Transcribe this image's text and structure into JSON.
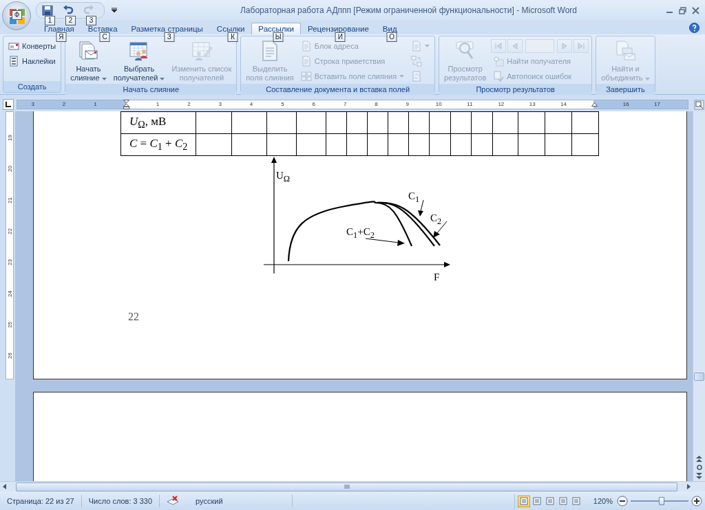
{
  "window": {
    "title": "Лабораторная работа АДппп [Режим ограниченной функциональности] - Microsoft Word"
  },
  "office_button": {
    "keytip": "Ф"
  },
  "quick_access": [
    {
      "keytip": "1",
      "disabled": false
    },
    {
      "keytip": "2",
      "disabled": false
    },
    {
      "keytip": "3",
      "disabled": true
    }
  ],
  "tabs": [
    {
      "label": "Главная",
      "keytip": "Я",
      "selected": false
    },
    {
      "label": "Вставка",
      "keytip": "С",
      "selected": false
    },
    {
      "label": "Разметка страницы",
      "keytip": "З",
      "selected": false
    },
    {
      "label": "Ссылки",
      "keytip": "К",
      "selected": false
    },
    {
      "label": "Рассылки",
      "keytip": "Ы",
      "selected": true
    },
    {
      "label": "Рецензирование",
      "keytip": "И",
      "selected": false
    },
    {
      "label": "Вид",
      "keytip": "О",
      "selected": false
    }
  ],
  "ribbon": {
    "groups": [
      {
        "title": "Создать",
        "items": [
          {
            "kind": "stack",
            "items": [
              {
                "kind": "small",
                "label": "Конверты",
                "disabled": false,
                "dropdown": false
              },
              {
                "kind": "small",
                "label": "Наклейки",
                "disabled": false,
                "dropdown": false
              }
            ]
          }
        ]
      },
      {
        "title": "Начать слияние",
        "items": [
          {
            "kind": "large",
            "lines": [
              "Начать",
              "слияние"
            ],
            "dropdown": true,
            "disabled": false
          },
          {
            "kind": "large",
            "lines": [
              "Выбрать",
              "получателей"
            ],
            "dropdown": true,
            "disabled": false
          },
          {
            "kind": "large",
            "lines": [
              "Изменить список",
              "получателей"
            ],
            "dropdown": false,
            "disabled": true
          }
        ]
      },
      {
        "title": "Составление документа и вставка полей",
        "items": [
          {
            "kind": "large",
            "lines": [
              "Выделить",
              "поля слияния"
            ],
            "dropdown": false,
            "disabled": true
          },
          {
            "kind": "stack",
            "items": [
              {
                "kind": "small",
                "label": "Блок адреса",
                "disabled": true,
                "dropdown": false
              },
              {
                "kind": "small",
                "label": "Строка приветствия",
                "disabled": true,
                "dropdown": false
              },
              {
                "kind": "small",
                "label": "Вставить поле слияния",
                "disabled": true,
                "dropdown": true
              }
            ]
          },
          {
            "kind": "stack",
            "items": [
              {
                "kind": "small",
                "disabled": true,
                "dropdown": true
              },
              {
                "kind": "small",
                "disabled": true,
                "dropdown": false
              },
              {
                "kind": "small",
                "disabled": true,
                "dropdown": false
              }
            ]
          }
        ]
      },
      {
        "title": "Просмотр результатов",
        "items": [
          {
            "kind": "large",
            "lines": [
              "Просмотр",
              "результатов"
            ],
            "dropdown": false,
            "disabled": true
          },
          {
            "kind": "stack",
            "items": [
              {
                "kind": "nav",
                "disabled": true
              },
              {
                "kind": "small",
                "label": "Найти получателя",
                "disabled": true,
                "dropdown": false
              },
              {
                "kind": "small",
                "label": "Автопоиск ошибок",
                "disabled": true,
                "dropdown": false
              }
            ]
          }
        ]
      },
      {
        "title": "Завершить",
        "items": [
          {
            "kind": "large",
            "lines": [
              "Найти и",
              "объединить"
            ],
            "dropdown": true,
            "disabled": true
          }
        ]
      }
    ]
  },
  "ruler": {
    "marks": [
      {
        "kind": "number",
        "text": "3"
      },
      {
        "kind": "number",
        "text": "2"
      },
      {
        "kind": "number",
        "text": "1"
      },
      {
        "kind": "indent"
      },
      {
        "kind": "number",
        "text": "1"
      },
      {
        "kind": "number",
        "text": "2"
      },
      {
        "kind": "number",
        "text": "3"
      },
      {
        "kind": "number",
        "text": "4"
      },
      {
        "kind": "number",
        "text": "5"
      },
      {
        "kind": "number",
        "text": "6"
      },
      {
        "kind": "number",
        "text": "7"
      },
      {
        "kind": "number",
        "text": "8"
      },
      {
        "kind": "number",
        "text": "9"
      },
      {
        "kind": "number",
        "text": "10"
      },
      {
        "kind": "number",
        "text": "11"
      },
      {
        "kind": "number",
        "text": "12"
      },
      {
        "kind": "number",
        "text": "13"
      },
      {
        "kind": "number",
        "text": "14"
      },
      {
        "kind": "right_indent"
      },
      {
        "kind": "number",
        "text": "16"
      },
      {
        "kind": "number",
        "text": "17"
      }
    ]
  },
  "vertical_ruler": {
    "labels": [
      "19",
      "20",
      "21",
      "22",
      "23",
      "24",
      "25",
      "26"
    ]
  },
  "document": {
    "table": {
      "rows": [
        {
          "label": "*U*$_{Ω}$, мВ"
        },
        {
          "label": "*C* = *C*$_{1}$ + *C*$_{2}$"
        }
      ]
    },
    "diagram": {
      "y_label": "U$_{Ω}$",
      "x_label": "F",
      "curve_labels": [
        "C$_{1}$",
        "C$_{2}$",
        "C$_{1}$+C$_{2}$"
      ]
    },
    "page_number": "22"
  },
  "status_bar": {
    "page": "Страница: 22 из 27",
    "words": "Число слов: 3 330",
    "language": "русский",
    "views": [
      {
        "selected": true
      },
      {
        "selected": false
      },
      {
        "selected": false
      },
      {
        "selected": false
      },
      {
        "selected": false
      }
    ],
    "zoom": "120%",
    "zoom_slider": {
      "level": 0.53
    }
  }
}
